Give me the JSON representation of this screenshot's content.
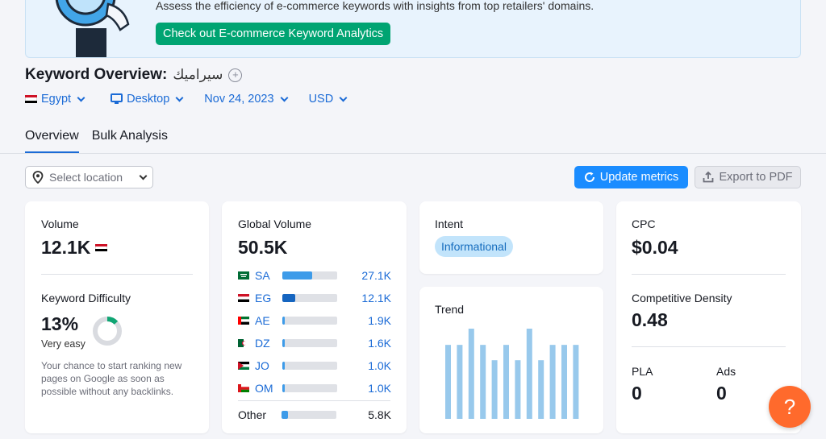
{
  "banner": {
    "text": "Assess the efficiency of e-commerce keywords with insights from top retailers' domains.",
    "button": "Check out E-commerce Keyword Analytics"
  },
  "header": {
    "title": "Keyword Overview:",
    "keyword": "سيراميك"
  },
  "filters": {
    "country": "Egypt",
    "device": "Desktop",
    "date": "Nov 24, 2023",
    "currency": "USD"
  },
  "tabs": [
    {
      "label": "Overview",
      "active": true
    },
    {
      "label": "Bulk Analysis",
      "active": false
    }
  ],
  "toolbar": {
    "location_placeholder": "Select location",
    "update_label": "Update metrics",
    "export_label": "Export to PDF"
  },
  "volume": {
    "label": "Volume",
    "value": "12.1K"
  },
  "keyword_difficulty": {
    "label": "Keyword Difficulty",
    "value": "13%",
    "level": "Very easy",
    "percent": 13,
    "description": "Your chance to start ranking new pages on Google as soon as possible without any backlinks."
  },
  "global_volume": {
    "label": "Global Volume",
    "value": "50.5K",
    "rows": [
      {
        "code": "SA",
        "value": "27.1K",
        "share": 0.54,
        "bar_color": "#3d9be9",
        "flag": "sa"
      },
      {
        "code": "EG",
        "value": "12.1K",
        "share": 0.24,
        "bar_color": "#1565c0",
        "flag": "eg"
      },
      {
        "code": "AE",
        "value": "1.9K",
        "share": 0.04,
        "bar_color": "#3d9be9",
        "flag": "ae"
      },
      {
        "code": "DZ",
        "value": "1.6K",
        "share": 0.035,
        "bar_color": "#3d9be9",
        "flag": "dz"
      },
      {
        "code": "JO",
        "value": "1.0K",
        "share": 0.025,
        "bar_color": "#3d9be9",
        "flag": "jo"
      },
      {
        "code": "OM",
        "value": "1.0K",
        "share": 0.025,
        "bar_color": "#3d9be9",
        "flag": "om"
      }
    ],
    "other": {
      "code": "Other",
      "value": "5.8K",
      "share": 0.12,
      "bar_color": "#3d9be9"
    }
  },
  "intent": {
    "label": "Intent",
    "value": "Informational"
  },
  "trend": {
    "label": "Trend",
    "chart_data": {
      "type": "bar",
      "values": [
        0.82,
        0.82,
        1.0,
        0.82,
        0.65,
        0.82,
        0.65,
        1.0,
        0.65,
        0.82,
        0.82,
        0.82
      ],
      "color": "#98c9ec"
    }
  },
  "cpc": {
    "label": "CPC",
    "value": "$0.04"
  },
  "competitive_density": {
    "label": "Competitive Density",
    "value": "0.48"
  },
  "pla": {
    "label": "PLA",
    "value": "0"
  },
  "ads": {
    "label": "Ads",
    "value": "0"
  },
  "help": {
    "label": "?"
  }
}
